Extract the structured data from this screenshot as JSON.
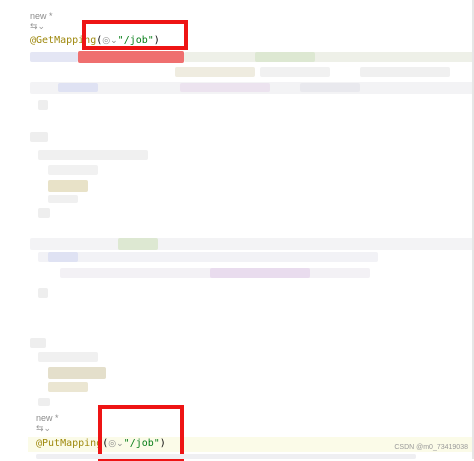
{
  "snippets": [
    {
      "usage_hint": "new *",
      "annotation": "@GetMapping",
      "open_paren": "(",
      "globe_icon": "globe-icon",
      "string_literal": "\"/job\"",
      "close_paren": ")"
    },
    {
      "usage_hint": "new *",
      "annotation": "@PutMapping",
      "open_paren": "(",
      "globe_icon": "globe-icon",
      "string_literal": "\"/job\"",
      "close_paren": ")"
    }
  ],
  "colors": {
    "annotation": "#9e880d",
    "string": "#067d17",
    "highlight_box": "#ee1414",
    "current_line": "#fbfbe8"
  },
  "watermark": "CSDN @m0_73419038"
}
